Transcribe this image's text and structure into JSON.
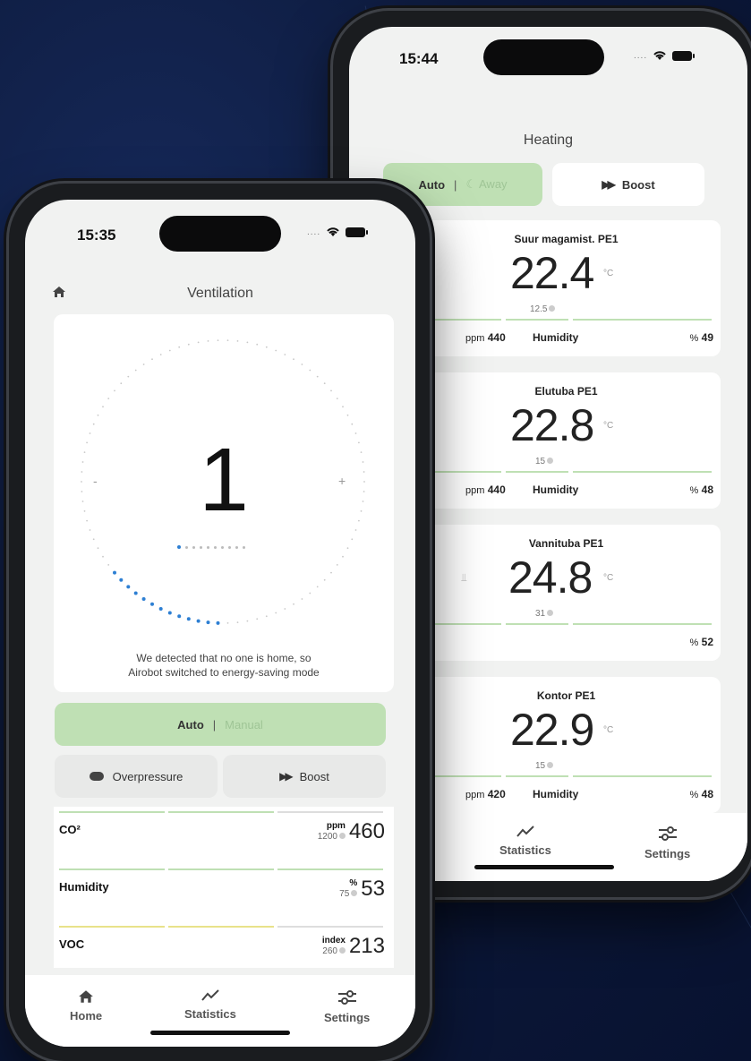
{
  "back_phone": {
    "status": {
      "time": "15:44"
    },
    "title": "Heating",
    "mode": {
      "auto": "Auto",
      "separator": "|",
      "away": "Away"
    },
    "boost": {
      "label": "Boost",
      "icon": "fast-forward-icon"
    },
    "rooms": [
      {
        "name": "Suur magamist. PE1",
        "temp": "22.4",
        "unit": "°C",
        "setpoint": "12.5",
        "ppm_unit": "ppm",
        "ppm": "440",
        "humidity_label": "Humidity",
        "hum_unit": "%",
        "humidity": "49"
      },
      {
        "name": "Elutuba PE1",
        "temp": "22.8",
        "unit": "°C",
        "setpoint": "15",
        "ppm_unit": "ppm",
        "ppm": "440",
        "humidity_label": "Humidity",
        "hum_unit": "%",
        "humidity": "48"
      },
      {
        "name": "Vannituba PE1",
        "temp": "24.8",
        "unit": "°C",
        "setpoint": "31",
        "hum_unit": "%",
        "humidity": "52",
        "partial_label": "y"
      },
      {
        "name": "Kontor PE1",
        "temp": "22.9",
        "unit": "°C",
        "setpoint": "15",
        "ppm_unit": "ppm",
        "ppm": "420",
        "humidity_label": "Humidity",
        "hum_unit": "%",
        "humidity": "48"
      }
    ],
    "nav": {
      "statistics": "Statistics",
      "settings": "Settings"
    }
  },
  "front_phone": {
    "status": {
      "time": "15:35"
    },
    "title": "Ventilation",
    "dial": {
      "value": "1",
      "minus": "-",
      "plus": "+",
      "level": 1,
      "max_level": 10
    },
    "message_line1": "We detected that no one is home, so",
    "message_line2": "Airobot switched to energy-saving mode",
    "mode": {
      "auto": "Auto",
      "separator": "|",
      "manual": "Manual"
    },
    "overpressure": {
      "label": "Overpressure"
    },
    "boost": {
      "label": "Boost"
    },
    "metrics": [
      {
        "label": "CO²",
        "unit": "ppm",
        "threshold": "1200",
        "value": "460"
      },
      {
        "label": "Humidity",
        "unit": "%",
        "threshold": "75",
        "value": "53"
      },
      {
        "label": "VOC",
        "unit": "index",
        "threshold": "260",
        "value": "213"
      }
    ],
    "nav": {
      "home": "Home",
      "statistics": "Statistics",
      "settings": "Settings"
    }
  },
  "colors": {
    "accent_green": "#bfe0b4",
    "dial_blue": "#2d7fd3",
    "voc_yellow": "#e8e28a"
  }
}
